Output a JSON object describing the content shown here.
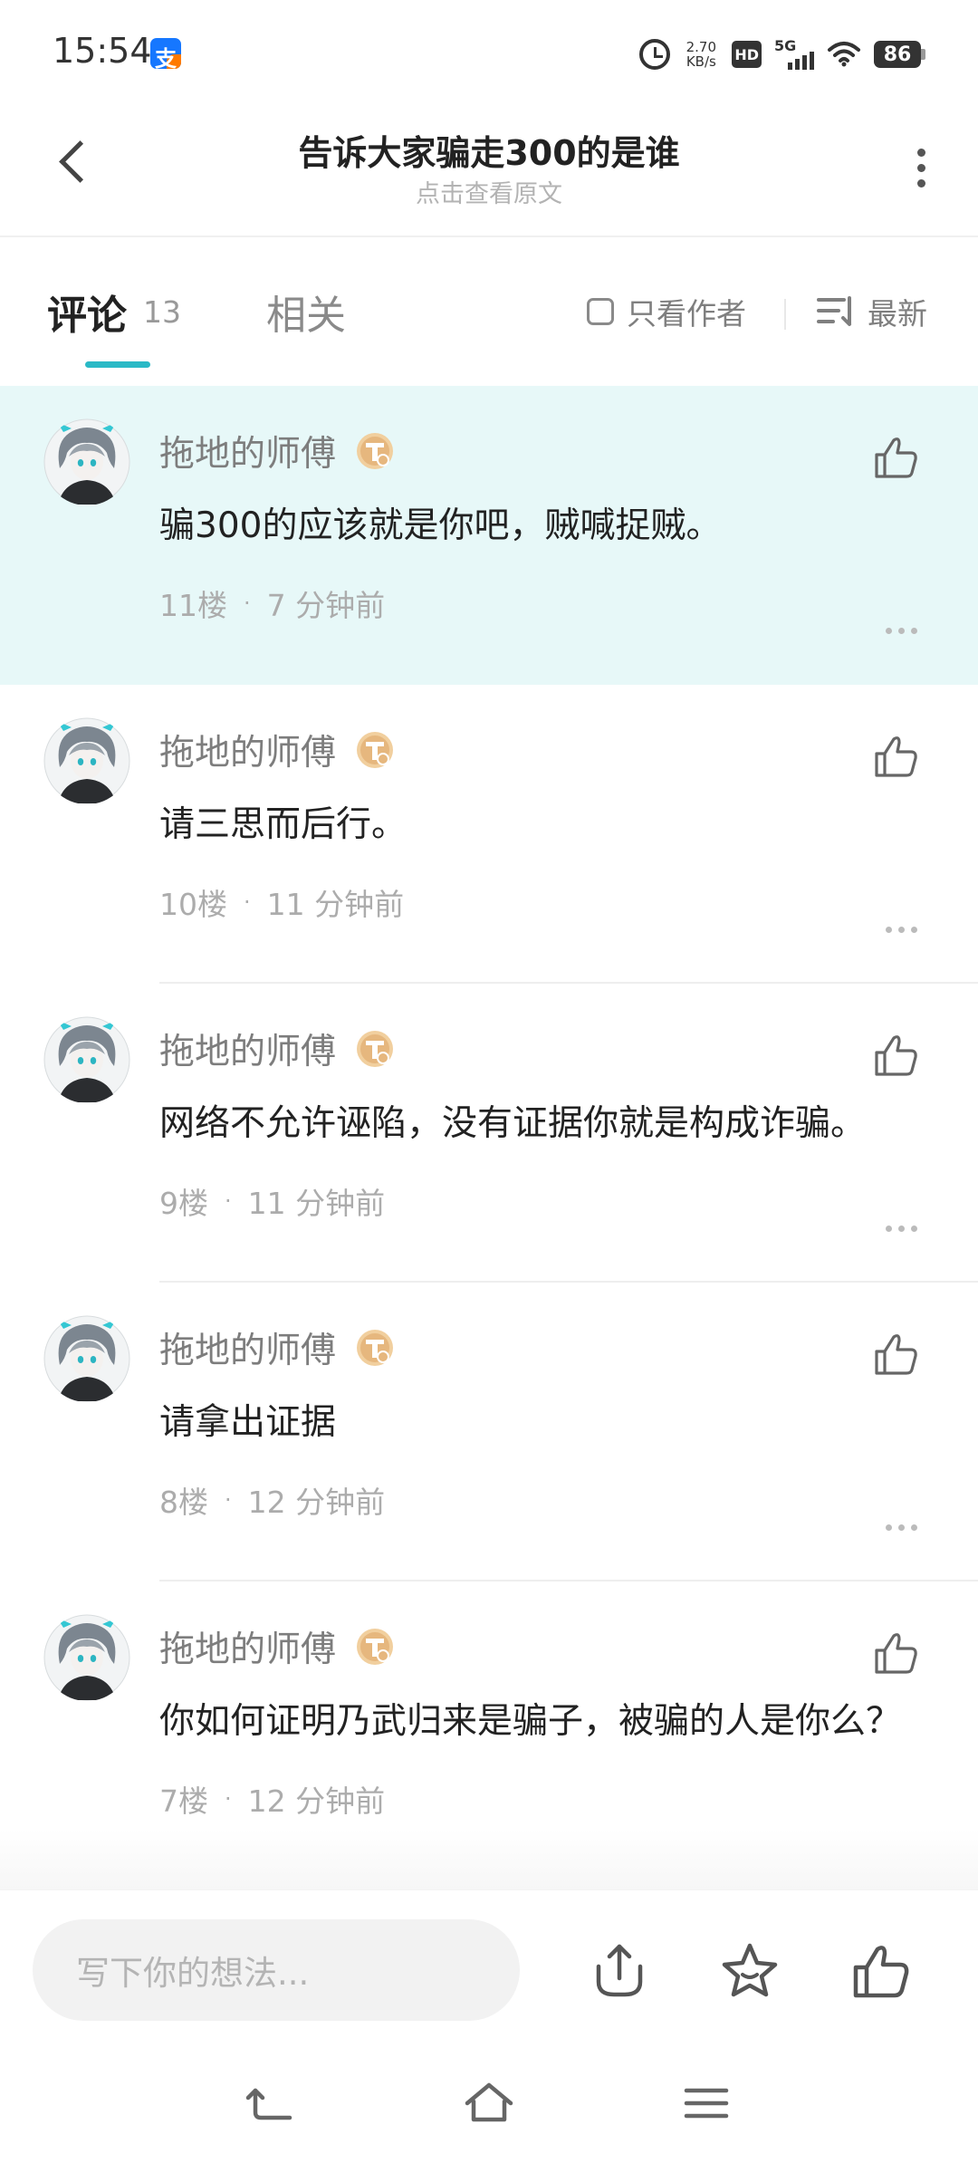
{
  "status_bar": {
    "time": "15:54",
    "app_icon": "alipay-icon",
    "app_icon_glyph": "支",
    "net_speed_value": "2.70",
    "net_speed_unit": "KB/s",
    "hd": "HD",
    "network": "5G",
    "battery": "86"
  },
  "header": {
    "title": "告诉大家骗走300的是谁",
    "subtitle": "点击查看原文",
    "back_icon": "back-arrow-icon",
    "more_icon": "vertical-dots-icon"
  },
  "tabs": {
    "comment_label": "评论",
    "comment_count": "13",
    "related_label": "相关",
    "only_author": "只看作者",
    "sort": "最新",
    "accent_color": "#2ab9c6"
  },
  "comments": [
    {
      "username": "拖地的师傅",
      "content": "骗300的应该就是你吧，贼喊捉贼。",
      "floor": "11楼",
      "time": "7 分钟前",
      "highlighted": true
    },
    {
      "username": "拖地的师傅",
      "content": "请三思而后行。",
      "floor": "10楼",
      "time": "11 分钟前",
      "highlighted": false
    },
    {
      "username": "拖地的师傅",
      "content": "网络不允许诬陷，没有证据你就是构成诈骗。",
      "floor": "9楼",
      "time": "11 分钟前",
      "highlighted": false
    },
    {
      "username": "拖地的师傅",
      "content": "请拿出证据",
      "floor": "8楼",
      "time": "12 分钟前",
      "highlighted": false
    },
    {
      "username": "拖地的师傅",
      "content": "你如何证明乃武归来是骗子，被骗的人是你么？",
      "floor": "7楼",
      "time": "12 分钟前",
      "highlighted": false
    }
  ],
  "bottom_bar": {
    "input_placeholder": "写下你的想法..."
  },
  "colors": {
    "highlight_bg": "#e7f8f8",
    "badge": "#e6b77e",
    "text_primary": "#222222",
    "text_secondary": "#7d7d7d"
  }
}
